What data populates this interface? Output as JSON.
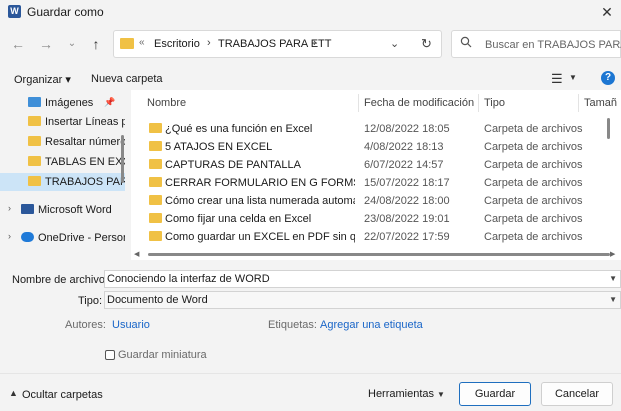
{
  "window": {
    "title": "Guardar como",
    "app_icon_letter": "W",
    "close": "✕"
  },
  "nav": {
    "back": "←",
    "forward": "→",
    "down": "⌄",
    "up": "↑"
  },
  "address": {
    "separator": "«",
    "crumbs": [
      "Escritorio",
      "TRABAJOS PARA ETT"
    ],
    "chevron": "›",
    "dropdown": "⌄",
    "refresh": "↻"
  },
  "search": {
    "placeholder": "Buscar en TRABAJOS PARA E..."
  },
  "toolbar": {
    "organize": "Organizar ▾",
    "new_folder": "Nueva carpeta",
    "view_icon": "☰",
    "view_caret": "▼",
    "help": "?"
  },
  "navpane": {
    "items": [
      {
        "label": "Imágenes",
        "icon": "pictures-icon",
        "pinned": true,
        "selected": false
      },
      {
        "label": "Insertar Líneas p",
        "icon": "folder-icon",
        "selected": false
      },
      {
        "label": "Resaltar número",
        "icon": "folder-icon",
        "selected": false
      },
      {
        "label": "TABLAS EN EXCE",
        "icon": "folder-icon",
        "selected": false
      },
      {
        "label": "TRABAJOS PARA",
        "icon": "folder-icon",
        "selected": true
      },
      {
        "label": "Microsoft Word",
        "icon": "word-icon",
        "expand": "›",
        "selected": false
      },
      {
        "label": "OneDrive - Person",
        "icon": "cloud-icon",
        "expand": "›",
        "selected": false
      }
    ]
  },
  "files": {
    "columns": [
      "Nombre",
      "Fecha de modificación",
      "Tipo",
      "Tamañ"
    ],
    "rows": [
      {
        "name": "¿Qué es una función en Excel",
        "date": "12/08/2022 18:05",
        "type": "Carpeta de archivos"
      },
      {
        "name": "5 ATAJOS EN EXCEL",
        "date": "4/08/2022 18:13",
        "type": "Carpeta de archivos"
      },
      {
        "name": "CAPTURAS DE PANTALLA",
        "date": "6/07/2022 14:57",
        "type": "Carpeta de archivos"
      },
      {
        "name": "CERRAR FORMULARIO EN G FORMS",
        "date": "15/07/2022 18:17",
        "type": "Carpeta de archivos"
      },
      {
        "name": "Cómo crear una lista numerada automáti...",
        "date": "24/08/2022 18:00",
        "type": "Carpeta de archivos"
      },
      {
        "name": "Como fijar una celda en Excel",
        "date": "23/08/2022 19:01",
        "type": "Carpeta de archivos"
      },
      {
        "name": "Como guardar un EXCEL en PDF sin que s...",
        "date": "22/07/2022 17:59",
        "type": "Carpeta de archivos"
      }
    ]
  },
  "form": {
    "filename_label": "Nombre de archivo:",
    "filename_value": "Conociendo la interfaz de WORD",
    "type_label": "Tipo:",
    "type_value": "Documento de Word",
    "authors_label": "Autores:",
    "authors_value": "Usuario",
    "tags_label": "Etiquetas:",
    "tags_value": "Agregar una etiqueta",
    "thumbnail_label": "Guardar miniatura"
  },
  "footer": {
    "hide_folders": "Ocultar carpetas",
    "tools": "Herramientas",
    "save": "Guardar",
    "cancel": "Cancelar"
  }
}
